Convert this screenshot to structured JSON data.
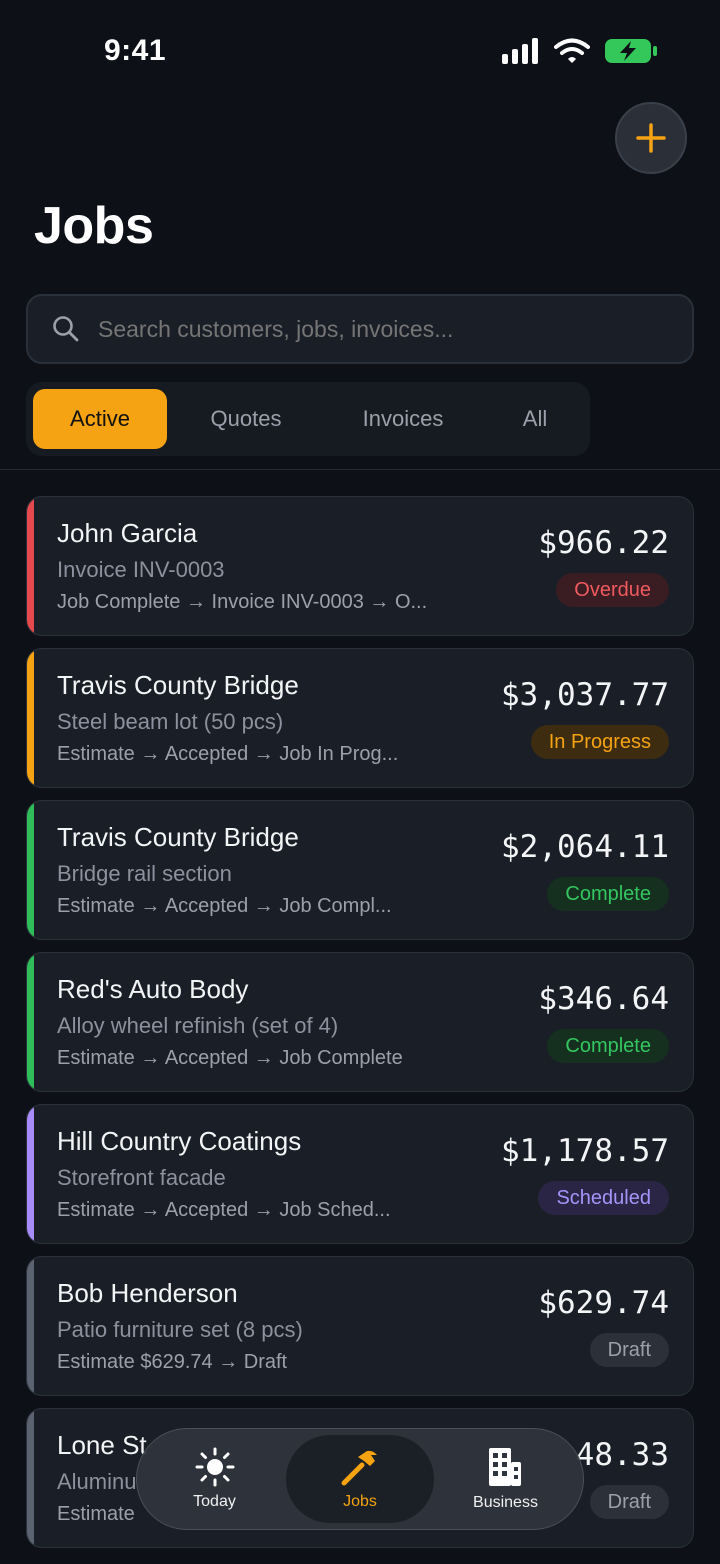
{
  "status_bar": {
    "time": "9:41"
  },
  "header": {
    "title": "Jobs",
    "add_button": "+"
  },
  "search": {
    "placeholder": "Search customers, jobs, invoices..."
  },
  "tabs": [
    {
      "label": "Active",
      "active": true
    },
    {
      "label": "Quotes",
      "active": false
    },
    {
      "label": "Invoices",
      "active": false
    },
    {
      "label": "All",
      "active": false
    }
  ],
  "jobs": [
    {
      "name": "John Garcia",
      "description": "Invoice INV-0003",
      "flow": "Job Complete → Invoice INV-0003 → O...",
      "amount": "$966.22",
      "status": "Overdue",
      "accent": "#e5484d",
      "badge_bg": "#3a1d22",
      "badge_fg": "#ef5a5f"
    },
    {
      "name": "Travis County Bridge",
      "description": "Steel beam lot (50 pcs)",
      "flow": "Estimate → Accepted → Job In Prog...",
      "amount": "$3,037.77",
      "status": "In Progress",
      "accent": "#f5a312",
      "badge_bg": "#3d2c10",
      "badge_fg": "#f5a312"
    },
    {
      "name": "Travis County Bridge",
      "description": "Bridge rail section",
      "flow": "Estimate → Accepted → Job Compl...",
      "amount": "$2,064.11",
      "status": "Complete",
      "accent": "#2ebd59",
      "badge_bg": "#15301f",
      "badge_fg": "#34c661"
    },
    {
      "name": "Red's Auto Body",
      "description": "Alloy wheel refinish (set of 4)",
      "flow": "Estimate → Accepted → Job Complete",
      "amount": "$346.64",
      "status": "Complete",
      "accent": "#2ebd59",
      "badge_bg": "#15301f",
      "badge_fg": "#34c661"
    },
    {
      "name": "Hill Country Coatings",
      "description": "Storefront facade",
      "flow": "Estimate → Accepted → Job Sched...",
      "amount": "$1,178.57",
      "status": "Scheduled",
      "accent": "#a78bfa",
      "badge_bg": "#2a2545",
      "badge_fg": "#a594f9"
    },
    {
      "name": "Bob Henderson",
      "description": "Patio furniture set (8 pcs)",
      "flow": "Estimate $629.74 → Draft",
      "amount": "$629.74",
      "status": "Draft",
      "accent": "#5b6270",
      "badge_bg": "#2c3139",
      "badge_fg": "#9aa1ab"
    },
    {
      "name": "Lone St",
      "description": "Aluminu",
      "flow": "Estimate",
      "amount": "48.33",
      "status": "Draft",
      "accent": "#5b6270",
      "badge_bg": "#2c3139",
      "badge_fg": "#9aa1ab"
    }
  ],
  "tabbar": [
    {
      "label": "Today",
      "icon": "sun-icon",
      "active": false
    },
    {
      "label": "Jobs",
      "icon": "hammer-icon",
      "active": true
    },
    {
      "label": "Business",
      "icon": "building-icon",
      "active": false
    }
  ]
}
